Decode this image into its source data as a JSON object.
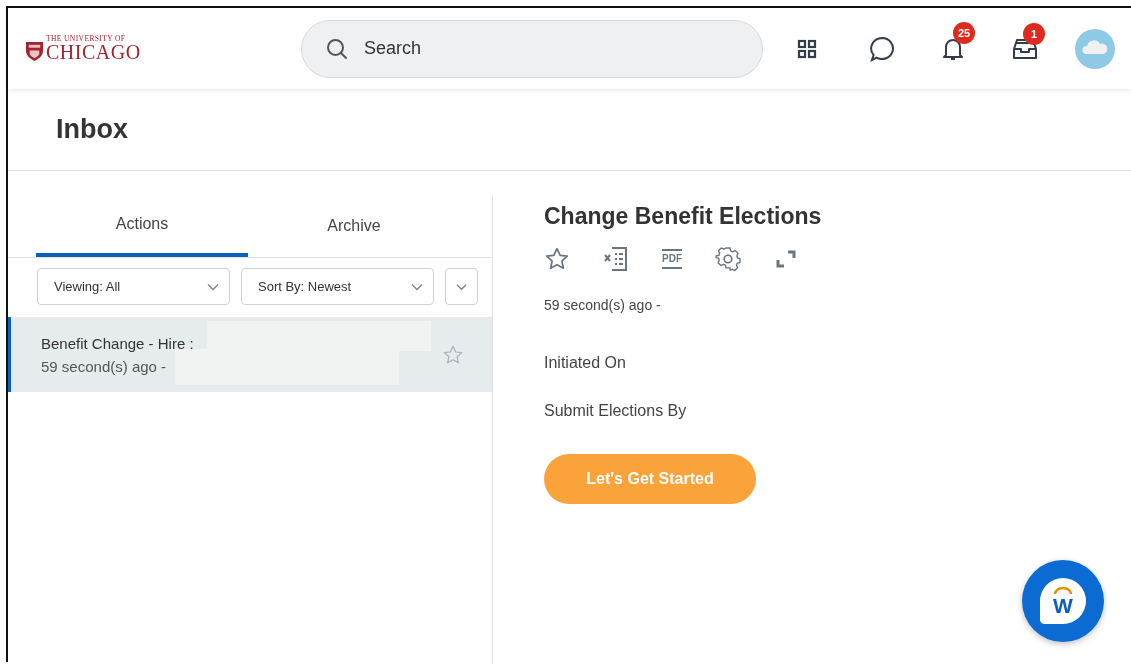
{
  "header": {
    "logo": {
      "line_1": "THE UNIVERSITY OF",
      "line_2": "CHICAGO"
    },
    "search": {
      "placeholder": "Search"
    },
    "notifications": {
      "count": "25"
    },
    "inbox": {
      "count": "1"
    }
  },
  "page_title": "Inbox",
  "tabs": [
    {
      "label": "Actions",
      "selected": true
    },
    {
      "label": "Archive",
      "selected": false
    }
  ],
  "filters": [
    {
      "kind": "dropdown",
      "label": "Viewing:",
      "value": "All"
    },
    {
      "kind": "dropdown",
      "label": "Sort By:",
      "value": "Newest"
    },
    {
      "kind": "toggle"
    }
  ],
  "items": [
    {
      "title": "Benefit Change - Hire :",
      "time": "59 second(s) ago -",
      "selected": true,
      "starred": false
    }
  ],
  "detail": {
    "title": "Change Benefit Elections",
    "pdf_label": "PDF",
    "time": "59 second(s) ago -",
    "fields": [
      "Initiated On",
      "Submit Elections By"
    ],
    "button": "Let's Get Started"
  },
  "assistant": {
    "letter": "W"
  }
}
